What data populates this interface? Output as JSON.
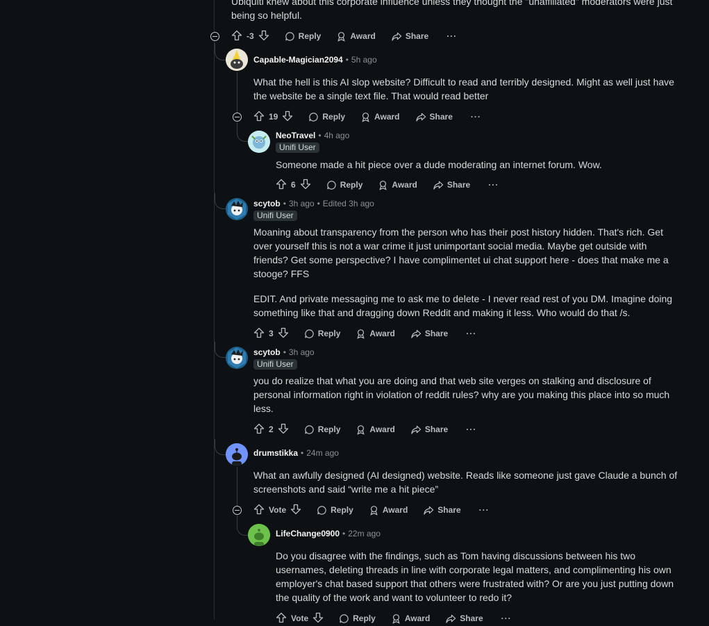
{
  "top_comment": {
    "text_tail_1": "Ubiquiti knew about this corporate influence unless they thought the \"unaffiliated\" moderators were just",
    "text_tail_2": "being so helpful.",
    "score": "-3"
  },
  "actions": {
    "reply": "Reply",
    "award": "Award",
    "share": "Share",
    "more": "···",
    "vote": "Vote"
  },
  "comments": [
    {
      "username": "Capable-Magician2094",
      "time": "5h ago",
      "text": "What the hell is this AI slop website? Difficult to read and terribly designed. Might as well just have the website be a single text file. That would read better",
      "score": "19"
    },
    {
      "username": "NeoTravel",
      "time": "4h ago",
      "flair": "Unifi User",
      "text": "Someone made a hit piece over a dude moderating an internet forum. Wow.",
      "score": "6"
    },
    {
      "username": "scytob",
      "time": "3h ago",
      "edited": "Edited 3h ago",
      "flair": "Unifi User",
      "text_p1": "Moaning about transparency from the person who has their post history hidden. That's rich. Get over yourself this is not a war crime it just unimportant social media. Maybe get outside with friends? Get some perspective? I have complimentet ui chat support here - does that make me a stooge? FFS",
      "text_p2": "EDIT. And private messaging me to ask me to delete - I never read rest of you DM. Imagine doing something like that and dragging down Reddit and making it less. Who would do that /s.",
      "score": "3"
    },
    {
      "username": "scytob",
      "time": "3h ago",
      "flair": "Unifi User",
      "text": "you do realize that what you are doing and that web site verges on stalking and disclosure of personal information right in violation of reddit rules? why are you making this place into so much less.",
      "score": "2"
    },
    {
      "username": "drumstikka",
      "time": "24m ago",
      "text": "What an awfully designed (AI designed) website. Reads like someone just gave Claude a bunch of screenshots and said “write me a hit piece”",
      "score": "Vote"
    },
    {
      "username": "LifeChange0900",
      "time": "22m ago",
      "text": "Do you disagree with the findings, such as Tom having discussions between his two usernames, deleting threads in line with corporate legal matters, and complimenting his own employer's chat based support that others were frustrated with? Or are you just putting down the quality of the work and want to volunteer to redo it?",
      "score": "Vote"
    }
  ],
  "colors": {
    "background": "#0e1113",
    "text": "#d7dadc",
    "muted": "#8a9196",
    "flair_bg": "#2a3236"
  }
}
